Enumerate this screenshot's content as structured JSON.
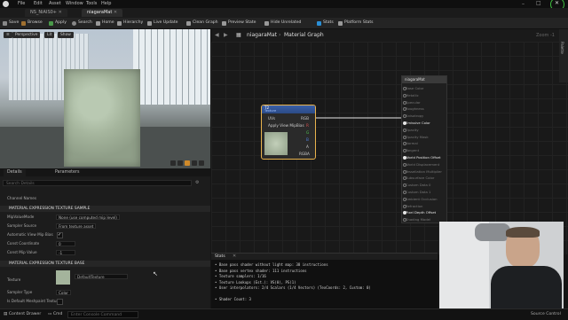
{
  "menu": [
    "File",
    "Edit",
    "Asset",
    "Window",
    "Tools",
    "Help"
  ],
  "tabs": [
    "NS_NiAIS0+",
    "niagaraMat"
  ],
  "toolbar": [
    "Save",
    "Browse",
    "Apply",
    "Search",
    "Home",
    "Hierarchy",
    "Live Update",
    "Clean Graph",
    "Preview State",
    "Hide Unrelated",
    "Stats",
    "Platform Stats"
  ],
  "viewport": {
    "perspective": "Perspective",
    "lit": "Lit",
    "show": "Show"
  },
  "details": {
    "tabs": [
      "Details",
      "Parameters"
    ],
    "search_placeholder": "Search Details",
    "rows_top": [
      "Channel Names"
    ],
    "section1": "MATERIAL EXPRESSION TEXTURE SAMPLE",
    "props1": [
      {
        "label": "MipValueMode",
        "value": "None (use computed mip level)"
      },
      {
        "label": "Sampler Source",
        "value": "From texture asset"
      },
      {
        "label": "Automatic View Mip Bias",
        "check": true
      },
      {
        "label": "Const Coordinate",
        "value": "0"
      },
      {
        "label": "Const Mip Value",
        "value": "-1"
      }
    ],
    "section2": "MATERIAL EXPRESSION TEXTURE BASE",
    "texture_label": "Texture",
    "texture_value": "DefaultTexture",
    "props2": [
      {
        "label": "Sampler Type",
        "value": "Color"
      },
      {
        "label": "Is Default Meshpaint Texture",
        "check": false
      }
    ]
  },
  "graph": {
    "breadcrumb": "niagaraMat",
    "breadcrumb2": "Material Graph",
    "zoom": "Zoom -1",
    "palette": "Palette",
    "node": {
      "title": "T2",
      "subtitle": "Texture",
      "inputs": [
        "UVs",
        "Apply View MipBias"
      ],
      "outputs": [
        "RGB",
        "R",
        "G",
        "B",
        "A",
        "RGBA"
      ]
    },
    "result": {
      "title": "niagaraMat",
      "pins": [
        {
          "label": "Base Color",
          "on": false
        },
        {
          "label": "Metallic",
          "on": false
        },
        {
          "label": "Specular",
          "on": false
        },
        {
          "label": "Roughness",
          "on": false
        },
        {
          "label": "Anisotropy",
          "on": false
        },
        {
          "label": "Emissive Color",
          "on": true
        },
        {
          "label": "Opacity",
          "on": false
        },
        {
          "label": "Opacity Mask",
          "on": false
        },
        {
          "label": "Normal",
          "on": false
        },
        {
          "label": "Tangent",
          "on": false
        },
        {
          "label": "World Position Offset",
          "on": true
        },
        {
          "label": "World Displacement",
          "on": false
        },
        {
          "label": "Tessellation Multiplier",
          "on": false
        },
        {
          "label": "Subsurface Color",
          "on": false
        },
        {
          "label": "Custom Data 0",
          "on": false
        },
        {
          "label": "Custom Data 1",
          "on": false
        },
        {
          "label": "Ambient Occlusion",
          "on": false
        },
        {
          "label": "Refraction",
          "on": false
        },
        {
          "label": "Pixel Depth Offset",
          "on": true
        },
        {
          "label": "Shading Model",
          "on": false
        }
      ]
    }
  },
  "stats": {
    "tab": "Stats",
    "lines": [
      "• Base pass shader without light map: 38 instructions",
      "• Base pass vertex shader: 111 instructions",
      "• Texture samplers: 1/16",
      "• Texture Lookups (Est.): VS(0), PS(1)",
      "• User interpolators: 2/4 Scalars (1/4 Vectors) (TexCoords: 2, Custom: 0)",
      "",
      "• Shader Count: 3"
    ]
  },
  "statusbar": {
    "content_drawer": "Content Drawer",
    "cmd": "Cmd",
    "console_placeholder": "Enter Console Command",
    "source_control": "Source Control"
  }
}
